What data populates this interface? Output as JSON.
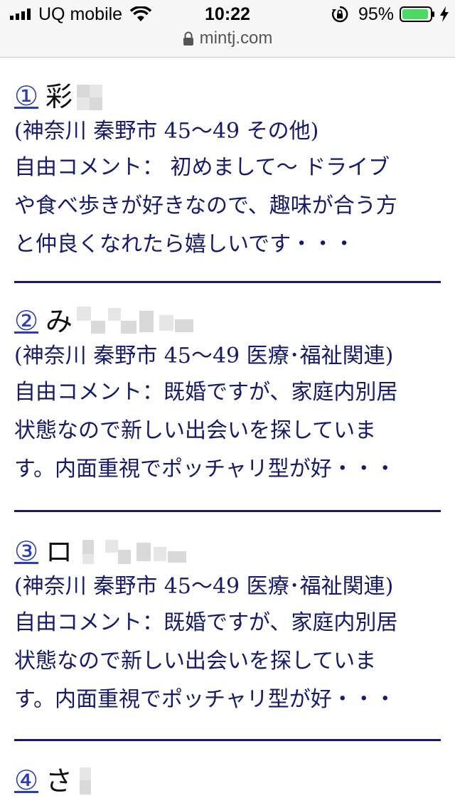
{
  "status": {
    "carrier": "UQ mobile",
    "time": "10:22",
    "battery": "95%",
    "battery_level": 0.95,
    "battery_color": "#4cd964"
  },
  "browser": {
    "url": "mintj.com"
  },
  "colors": {
    "link": "#2a3bbf",
    "text": "#161a6e",
    "divider": "#161a6e"
  },
  "entries": [
    {
      "number": "①",
      "name": "彩",
      "meta": "(神奈川 秦野市 45〜49 その他)",
      "comment_lines": [
        "自由コメント： 初めまして〜 ドライブ",
        "や食べ歩きが好きなので、趣味が合う方",
        "と仲良くなれたら嬉しいです・・・"
      ]
    },
    {
      "number": "②",
      "name": "み",
      "meta": "(神奈川 秦野市 45〜49 医療･福祉関連)",
      "comment_lines": [
        "自由コメント：既婚ですが、家庭内別居",
        "状態なので新しい出会いを探していま",
        "す。内面重視でポッチャリ型が好・・・"
      ]
    },
    {
      "number": "③",
      "name": "ロ",
      "meta": "(神奈川 秦野市 45〜49 医療･福祉関連)",
      "comment_lines": [
        "自由コメント：既婚ですが、家庭内別居",
        "状態なので新しい出会いを探していま",
        "す。内面重視でポッチャリ型が好・・・"
      ]
    },
    {
      "number": "④",
      "name": "さ"
    }
  ]
}
